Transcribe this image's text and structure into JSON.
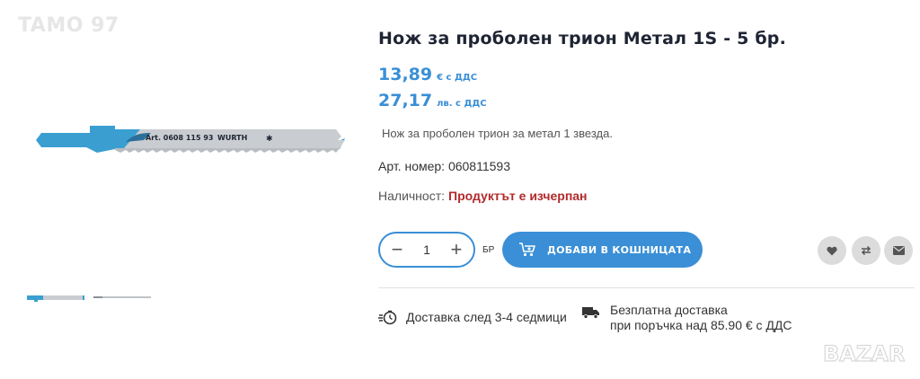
{
  "watermark": {
    "top_text": "TAMO 97",
    "bottom_text": "BAZAR"
  },
  "product": {
    "title": "Нож за проболен трион Метал 1S - 5 бр.",
    "price_eur": {
      "amount": "13,89",
      "unit": "€ с ДДС"
    },
    "price_bgn": {
      "amount": "27,17",
      "unit": "лв. с ДДС"
    },
    "description": "Нож за проболен трион за метал 1 звезда.",
    "article_number": "Арт. номер: 060811593",
    "availability_label": "Наличност:",
    "availability_status": "Продуктът е изчерпан",
    "image_art_text": "Art. 0608 115 93",
    "image_brand_text": "WURTH"
  },
  "cart": {
    "quantity": "1",
    "quantity_unit": "БР",
    "minus_label": "−",
    "plus_label": "+",
    "add_to_cart_label": "ДОБАВИ В КОШНИЦАТА"
  },
  "info": {
    "delivery_text": "Доставка след 3-4 седмици",
    "shipping_line1": "Безплатна доставка",
    "shipping_line2": "при поръчка над 85.90 € с ДДС"
  },
  "colors": {
    "accent": "#3a8fd6",
    "out_of_stock": "#b22a2a",
    "title": "#1e2433",
    "round_button_bg": "#dcdcdc"
  },
  "icons": [
    "cart-plus-icon",
    "heart-icon",
    "compare-icon",
    "envelope-icon",
    "fast-delivery-icon",
    "truck-icon"
  ]
}
